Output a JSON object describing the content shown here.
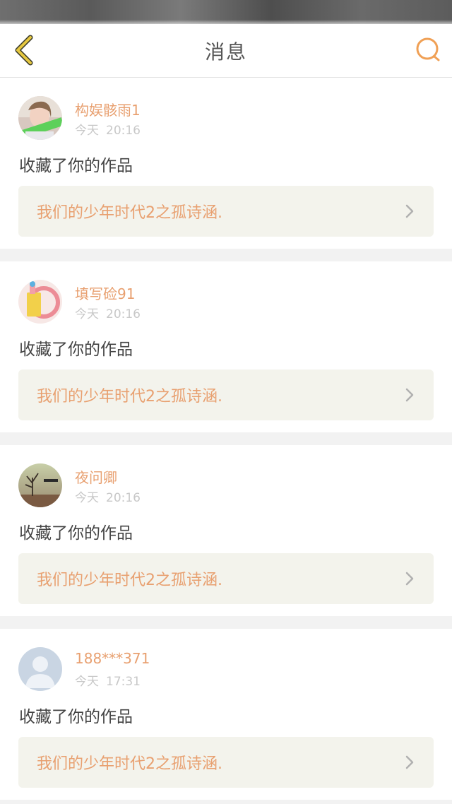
{
  "header": {
    "title": "消息",
    "back_icon": "back-chevron-icon",
    "search_icon": "search-icon",
    "accent_color": "#f0a055",
    "back_color": "#e6c840"
  },
  "notifications": [
    {
      "user": "构娱骸雨1",
      "day": "今天",
      "time": "20:16",
      "action": "收藏了你的作品",
      "work": "我们的少年时代2之孤诗涵.",
      "avatar": "photo-avatar"
    },
    {
      "user": "填写硷91",
      "day": "今天",
      "time": "20:16",
      "action": "收藏了你的作品",
      "work": "我们的少年时代2之孤诗涵.",
      "avatar": "cartoon-avatar"
    },
    {
      "user": "夜问卿",
      "day": "今天",
      "time": "20:16",
      "action": "收藏了你的作品",
      "work": "我们的少年时代2之孤诗涵.",
      "avatar": "landscape-avatar"
    },
    {
      "user": "188***371",
      "day": "今天",
      "time": "17:31",
      "action": "收藏了你的作品",
      "work": "我们的少年时代2之孤诗涵.",
      "avatar": "default-avatar"
    }
  ]
}
